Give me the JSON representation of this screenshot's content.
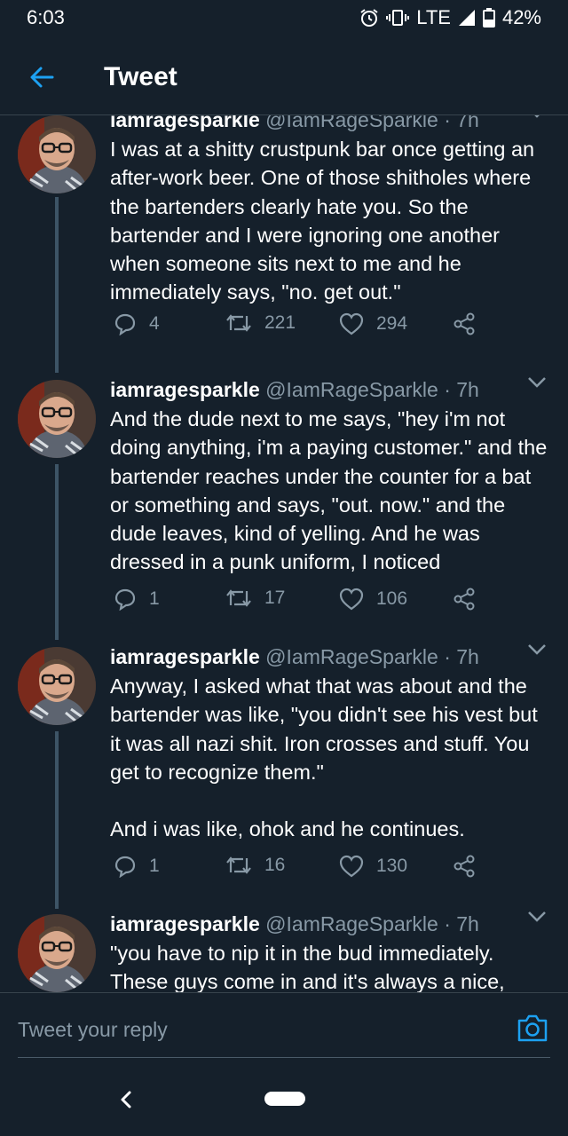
{
  "status_bar": {
    "time": "6:03",
    "network": "LTE",
    "battery": "42%"
  },
  "header": {
    "title": "Tweet"
  },
  "tweets": [
    {
      "name": "iamragesparkle",
      "handle": "@IamRageSparkle · 7h",
      "text": "I was at a shitty crustpunk bar once getting an after-work beer. One of those shitholes where the bartenders clearly hate you. So the bartender and I were ignoring one another when someone sits next to me and he immediately says, \"no. get out.\"",
      "replies": "4",
      "retweets": "221",
      "likes": "294"
    },
    {
      "name": "iamragesparkle",
      "handle": "@IamRageSparkle · 7h",
      "text": "And the dude next to me says, \"hey i'm not doing anything, i'm a paying customer.\" and the bartender reaches under the counter for a bat or something and says, \"out. now.\" and the dude leaves, kind of yelling. And he was dressed in a punk uniform, I noticed",
      "replies": "1",
      "retweets": "17",
      "likes": "106"
    },
    {
      "name": "iamragesparkle",
      "handle": "@IamRageSparkle · 7h",
      "text": "Anyway, I asked what that was about and the bartender was like, \"you didn't see his vest but it was all nazi shit. Iron crosses and stuff. You get to recognize them.\"\n\nAnd i was like, ohok and he continues.",
      "replies": "1",
      "retweets": "16",
      "likes": "130"
    },
    {
      "name": "iamragesparkle",
      "handle": "@IamRageSparkle · 7h",
      "text": "\"you have to nip it in the bud immediately. These guys come in and it's always a nice,"
    }
  ],
  "reply_box": {
    "placeholder": "Tweet your reply"
  },
  "colors": {
    "background": "#15202b",
    "accent": "#1da1f2",
    "muted": "#8899a6"
  }
}
